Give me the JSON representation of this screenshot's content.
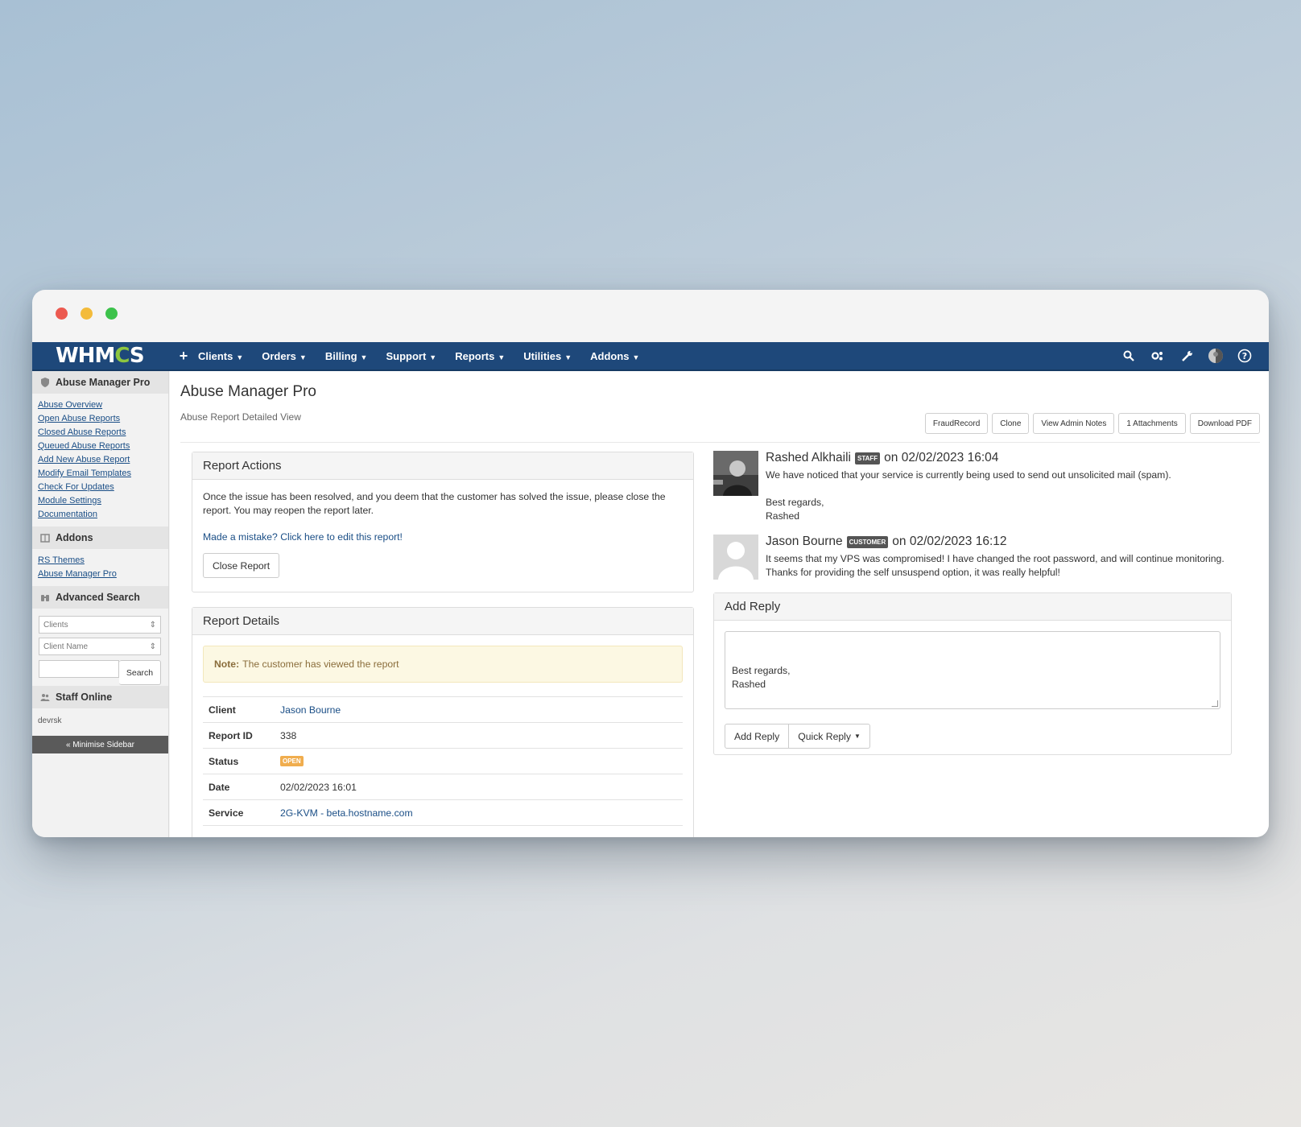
{
  "nav": {
    "logo": "WHMCS",
    "plus": "+",
    "menu": [
      "Clients",
      "Orders",
      "Billing",
      "Support",
      "Reports",
      "Utilities",
      "Addons"
    ],
    "icons": [
      "search-icon",
      "gears-icon",
      "wrench-icon",
      "user-avatar-icon",
      "help-icon"
    ]
  },
  "sidebar": {
    "sections": {
      "amp": {
        "title": "Abuse Manager Pro",
        "links": [
          "Abuse Overview",
          "Open Abuse Reports",
          "Closed Abuse Reports",
          "Queued Abuse Reports",
          "Add New Abuse Report",
          "Modify Email Templates",
          "Check For Updates",
          "Module Settings",
          "Documentation"
        ]
      },
      "addons": {
        "title": "Addons",
        "links": [
          "RS Themes",
          "Abuse Manager Pro"
        ]
      },
      "search": {
        "title": "Advanced Search",
        "select1": "Clients",
        "select2": "Client Name",
        "button": "Search"
      },
      "staff": {
        "title": "Staff Online",
        "name": "devrsk"
      }
    },
    "minimise": "« Minimise Sidebar"
  },
  "page": {
    "title": "Abuse Manager Pro",
    "subtitle": "Abuse Report Detailed View",
    "buttons": [
      "FraudRecord",
      "Clone",
      "View Admin Notes",
      "1 Attachments",
      "Download PDF"
    ]
  },
  "actions": {
    "title": "Report Actions",
    "text": "Once the issue has been resolved, and you deem that the customer has solved the issue, please close the report. You may reopen the report later.",
    "link": "Made a mistake? Click here to edit this report!",
    "button": "Close Report"
  },
  "details": {
    "title": "Report Details",
    "note_label": "Note:",
    "note_text": "The customer has viewed the report",
    "rows": [
      {
        "label": "Client",
        "value": "Jason Bourne"
      },
      {
        "label": "Report ID",
        "value": "338"
      },
      {
        "label": "Status",
        "value": "OPEN"
      },
      {
        "label": "Date",
        "value": "02/02/2023 16:01"
      },
      {
        "label": "Service",
        "value": "2G-KVM - beta.hostname.com"
      }
    ]
  },
  "messages": [
    {
      "author": "Rashed Alkhaili",
      "tag": "STAFF",
      "when": "on 02/02/2023 16:04",
      "line1": "We have noticed that your service is currently being used to send out unsolicited mail (spam).",
      "line2": "Best regards,",
      "line3": "Rashed"
    },
    {
      "author": "Jason Bourne",
      "tag": "CUSTOMER",
      "when": "on 02/02/2023 16:12",
      "line1": "It seems that my VPS was compromised! I have changed the root password, and will continue monitoring. Thanks for providing the self unsuspend option, it was really helpful!"
    }
  ],
  "reply": {
    "title": "Add Reply",
    "line1": "Best regards,",
    "line2": "Rashed",
    "add_button": "Add Reply",
    "quick_button": "Quick Reply"
  },
  "colors": {
    "navbar": "#1e487a",
    "link": "#1a4e86",
    "status_open": "#f0ad4e",
    "note_bg": "#fcf8e3"
  }
}
